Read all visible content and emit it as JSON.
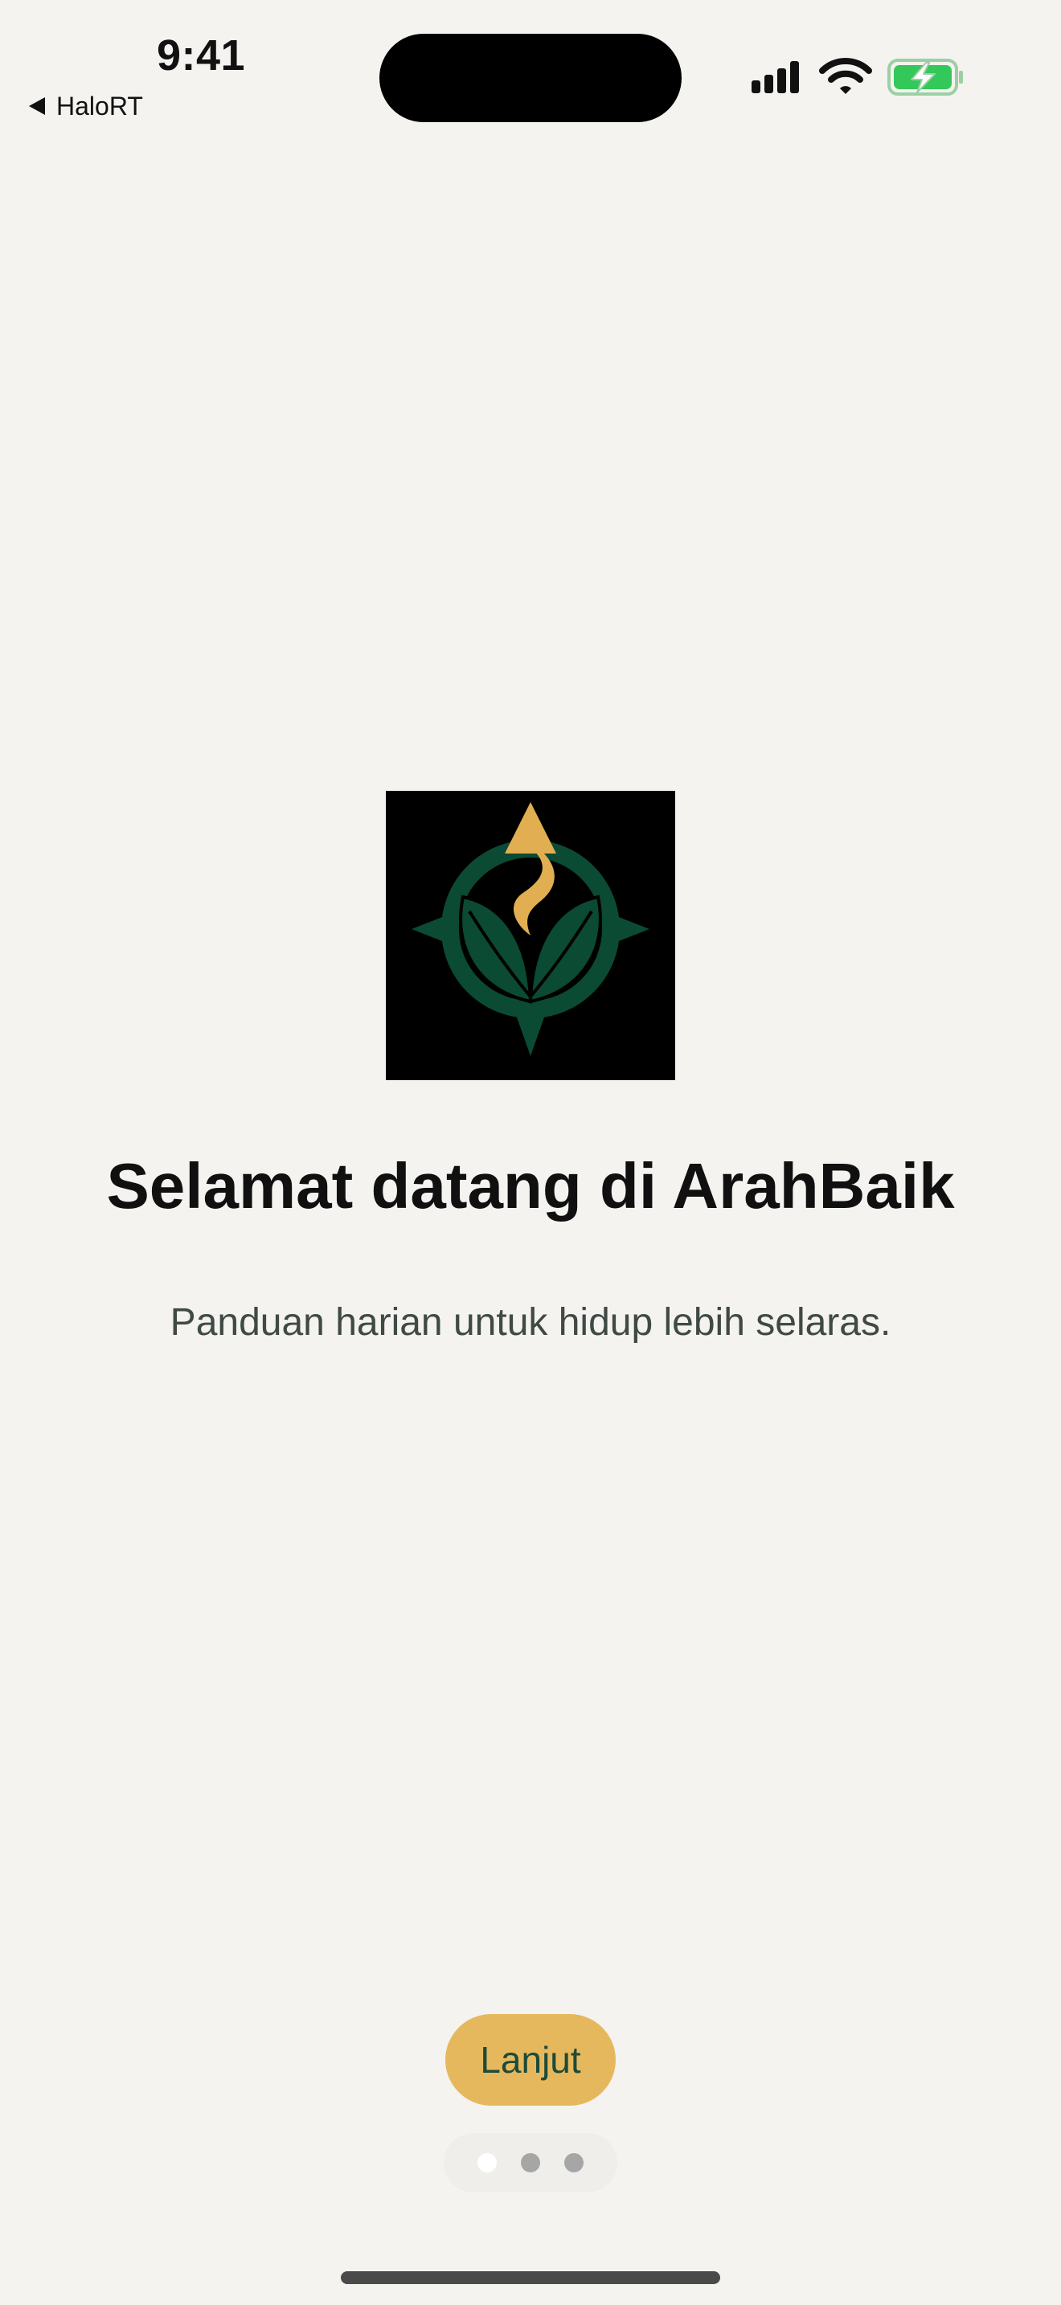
{
  "status_bar": {
    "time": "9:41",
    "back_app": "HaloRT",
    "icons": [
      "signal-bars-icon",
      "wifi-icon",
      "battery-charging-icon"
    ],
    "battery_color": "#34C759"
  },
  "onboarding": {
    "title": "Selamat datang di ArahBaik",
    "subtitle": "Panduan harian untuk hidup lebih selaras.",
    "next_label": "Lanjut",
    "page_count": 3,
    "active_page": 1
  },
  "colors": {
    "background": "#F4F3EF",
    "accent": "#E6B85E",
    "brand_green": "#0B4A33",
    "button_text": "#1E4A37"
  }
}
